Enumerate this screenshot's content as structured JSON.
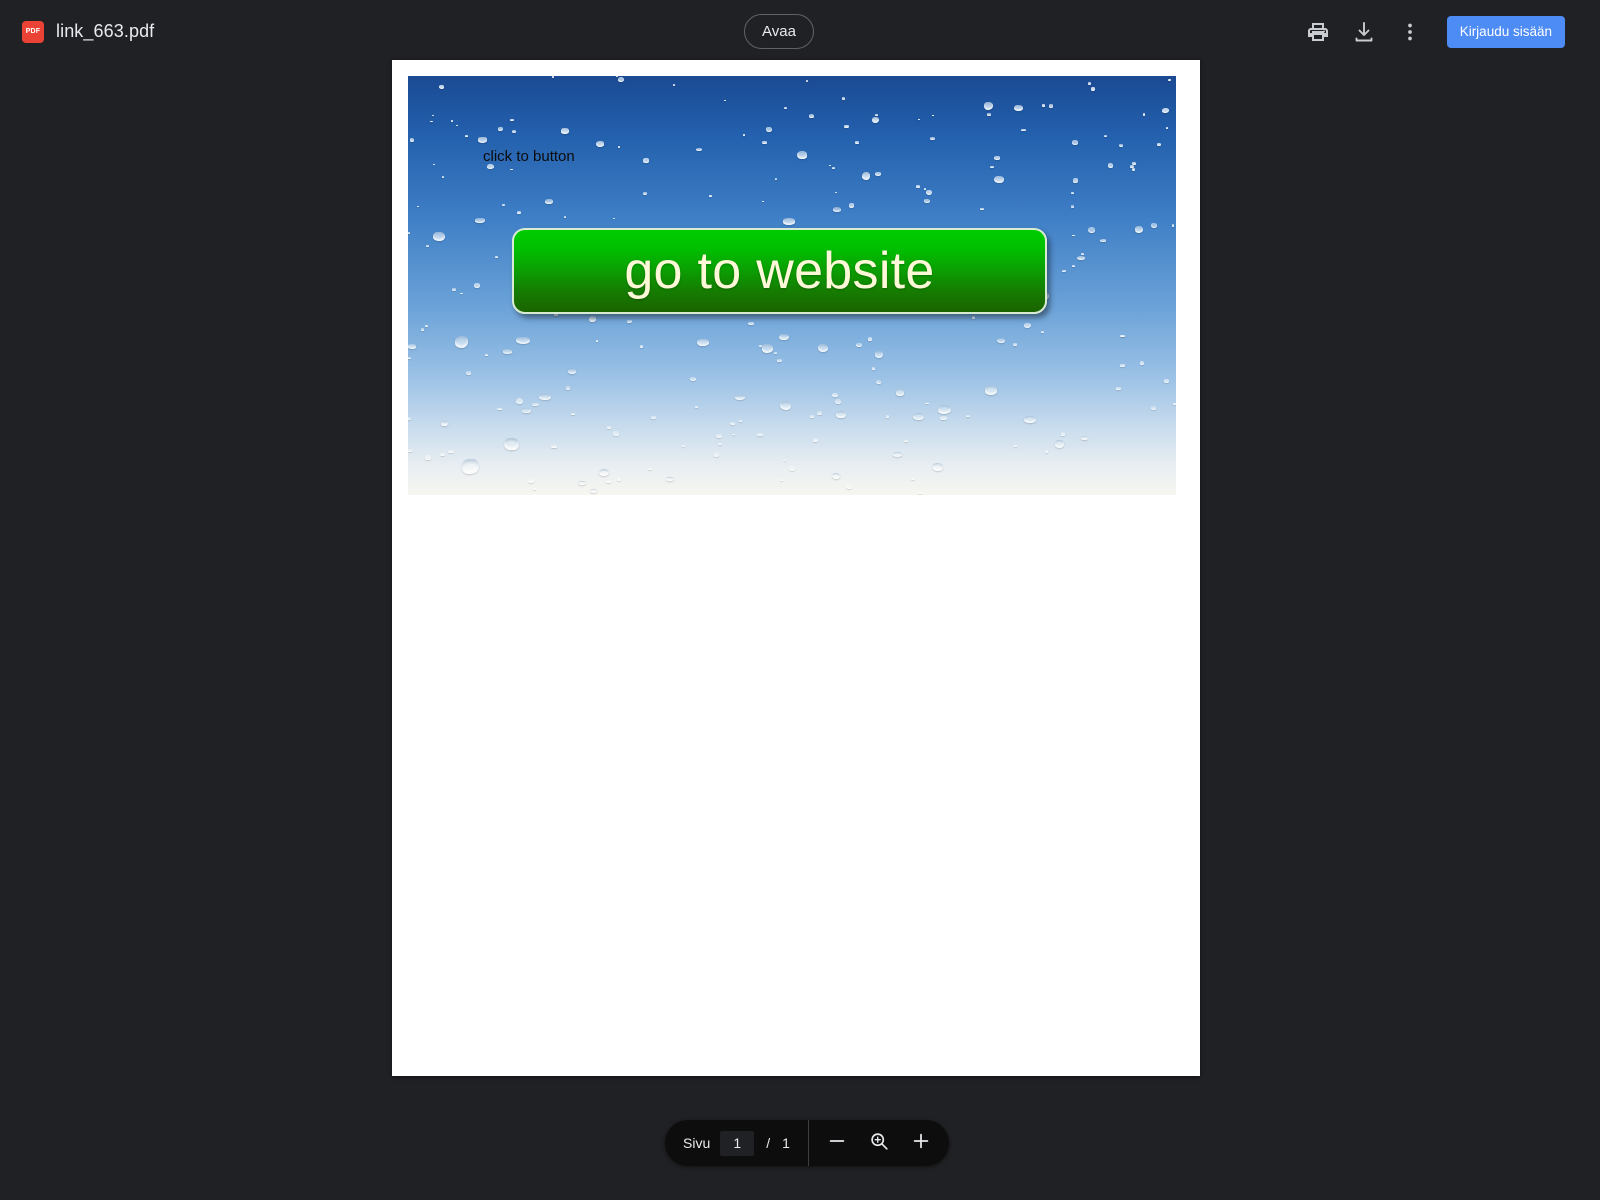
{
  "header": {
    "file_icon": "pdf-file-icon",
    "file_name": "link_663.pdf",
    "open_label": "Avaa",
    "print_icon": "print-icon",
    "download_icon": "download-icon",
    "more_icon": "more-vertical-icon",
    "signin_label": "Kirjaudu sisään",
    "accent_color": "#4d8bf5",
    "bg_color": "#202124",
    "pdf_badge_text": "PDF",
    "pdf_badge_color": "#ea4335"
  },
  "document": {
    "caption": "click to button",
    "button_label": "go to website",
    "button_color_top": "#00cc00",
    "button_color_bottom": "#1b6300",
    "button_text_color": "#fdf8d8",
    "page_bg": "#ffffff"
  },
  "toolbar": {
    "page_label": "Sivu",
    "current_page": "1",
    "separator": "/",
    "total_pages": "1",
    "zoom_out_icon": "minus-icon",
    "zoom_reset_icon": "zoom-in-magnifier-icon",
    "zoom_in_icon": "plus-icon"
  }
}
